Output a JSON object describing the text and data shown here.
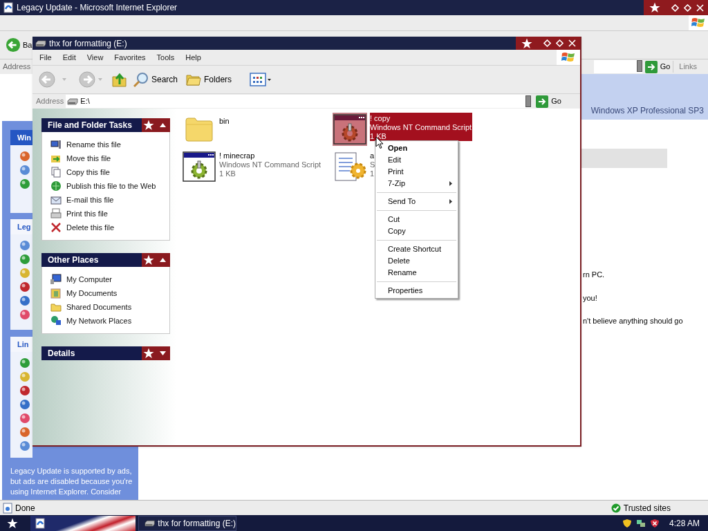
{
  "ie_window": {
    "title": "Legacy Update - Microsoft Internet Explorer",
    "back_button": {
      "label": "Ba"
    },
    "address_bar": {
      "label": "Address",
      "go": "Go",
      "links": "Links"
    },
    "banner": {
      "text": "Windows XP Professional SP3"
    },
    "sidebar": {
      "sections": [
        {
          "heading": "Win",
          "selected": true
        },
        {
          "heading": "Leg",
          "selected": false
        },
        {
          "heading": "Lin",
          "selected": false
        }
      ],
      "footer": "Legacy Update is supported by ads, but ads are disabled because you're using Internet Explorer. Consider"
    },
    "body_lines": [
      "rn PC.",
      "you!",
      "n't believe anything should go"
    ],
    "status_bar": {
      "status": "Done",
      "zone": "Trusted sites"
    }
  },
  "explorer_window": {
    "title": "thx for formatting (E:)",
    "menu": [
      "File",
      "Edit",
      "View",
      "Favorites",
      "Tools",
      "Help"
    ],
    "toolbar": {
      "search": "Search",
      "folders": "Folders"
    },
    "address_bar": {
      "label": "Address",
      "value": "E:\\",
      "go": "Go"
    },
    "task_panes": [
      {
        "title": "File and Folder Tasks",
        "expanded": true,
        "items": [
          {
            "label": "Rename this file",
            "kind": "rename"
          },
          {
            "label": "Move this file",
            "kind": "move"
          },
          {
            "label": "Copy this file",
            "kind": "copy"
          },
          {
            "label": "Publish this file to the Web",
            "kind": "web"
          },
          {
            "label": "E-mail this file",
            "kind": "mail"
          },
          {
            "label": "Print this file",
            "kind": "print"
          },
          {
            "label": "Delete this file",
            "kind": "delete"
          }
        ]
      },
      {
        "title": "Other Places",
        "expanded": true,
        "items": [
          {
            "label": "My Computer",
            "kind": "computer"
          },
          {
            "label": "My Documents",
            "kind": "documents"
          },
          {
            "label": "Shared Documents",
            "kind": "folder"
          },
          {
            "label": "My Network Places",
            "kind": "network"
          }
        ]
      },
      {
        "title": "Details",
        "expanded": false
      }
    ],
    "files": [
      {
        "name": "bin",
        "kind": "folder",
        "selected": false
      },
      {
        "name": "! copy",
        "type": "Windows NT Command Script",
        "size": "1 KB",
        "kind": "script",
        "selected": true
      },
      {
        "name": "! minecrap",
        "type": "Windows NT Command Script",
        "size": "1 KB",
        "kind": "script",
        "selected": false
      },
      {
        "name": "a",
        "type": "S",
        "size": "1",
        "kind": "settings",
        "selected": false
      }
    ],
    "context_menu": [
      {
        "kind": "default",
        "label": "Open"
      },
      {
        "kind": "item",
        "label": "Edit"
      },
      {
        "kind": "item",
        "label": "Print"
      },
      {
        "kind": "submenu",
        "label": "7-Zip"
      },
      {
        "kind": "separator"
      },
      {
        "kind": "submenu",
        "label": "Send To"
      },
      {
        "kind": "separator"
      },
      {
        "kind": "item",
        "label": "Cut"
      },
      {
        "kind": "item",
        "label": "Copy"
      },
      {
        "kind": "separator"
      },
      {
        "kind": "item",
        "label": "Create Shortcut"
      },
      {
        "kind": "item",
        "label": "Delete"
      },
      {
        "kind": "item",
        "label": "Rename"
      },
      {
        "kind": "separator"
      },
      {
        "kind": "item",
        "label": "Properties"
      }
    ]
  },
  "taskbar": {
    "tasks": [
      {
        "label": "thx for formatting (E:)",
        "selected": false
      }
    ],
    "clock": "4:28 AM"
  }
}
